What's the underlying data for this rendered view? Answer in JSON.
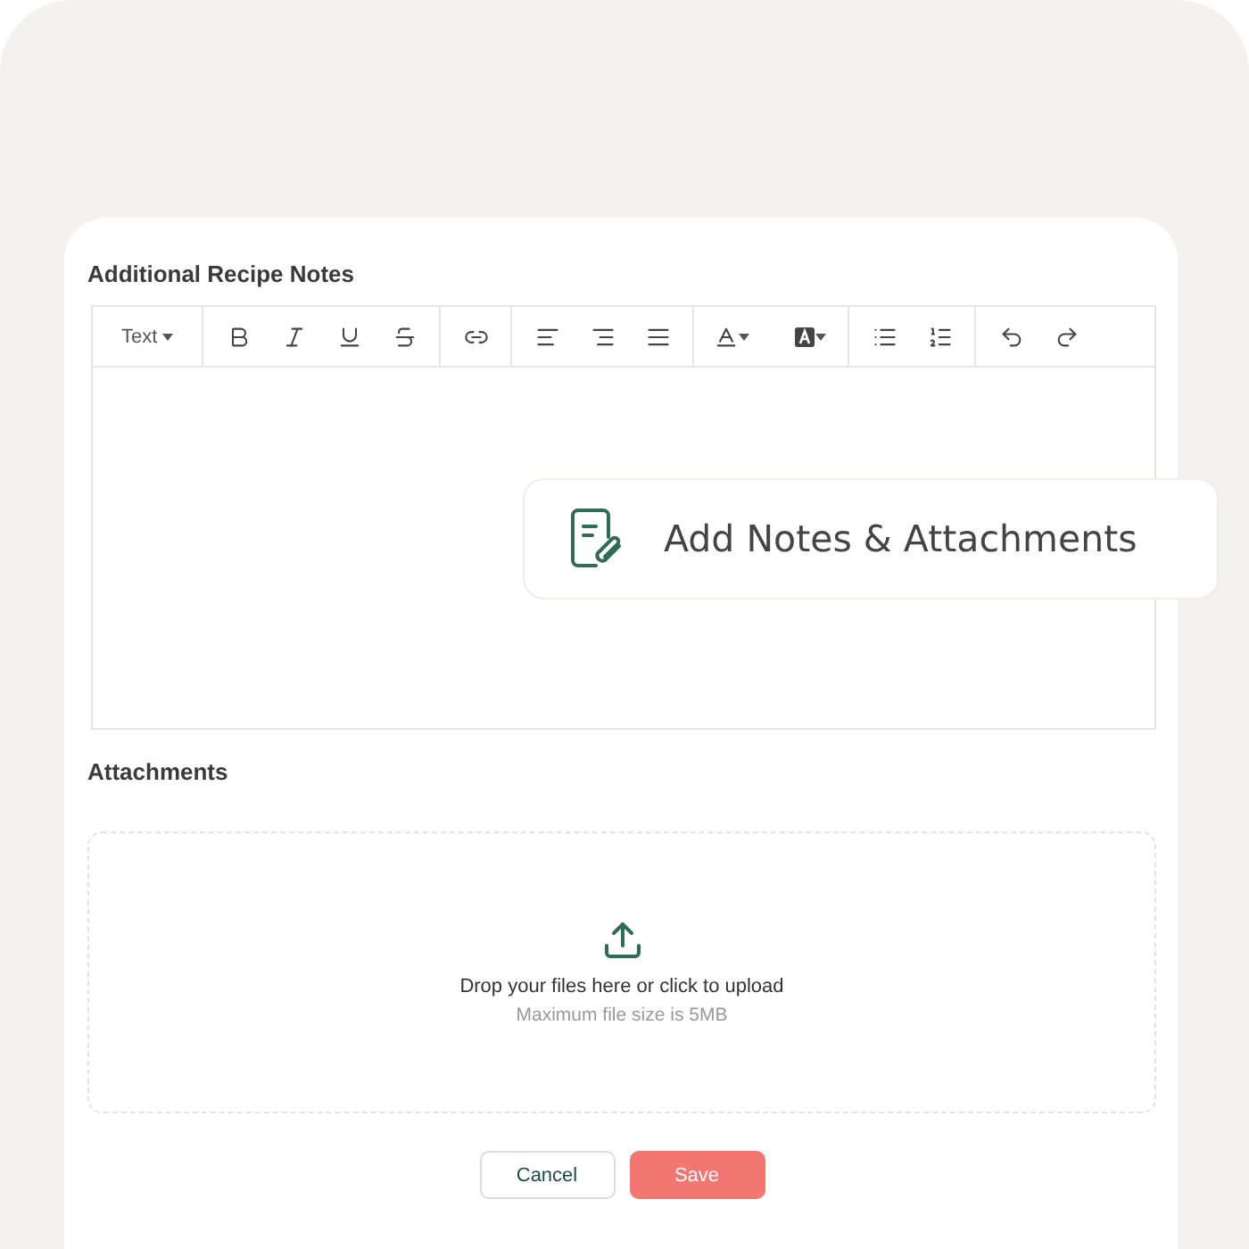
{
  "notes": {
    "title": "Additional Recipe Notes",
    "format_dropdown": "Text"
  },
  "callout": {
    "label": "Add Notes & Attachments"
  },
  "attachments": {
    "title": "Attachments",
    "prompt": "Drop your files here or click to upload",
    "hint": "Maximum file size is 5MB"
  },
  "buttons": [
    {
      "label": "Cancel",
      "kind": "secondary"
    },
    {
      "label": "Save",
      "kind": "primary"
    }
  ]
}
